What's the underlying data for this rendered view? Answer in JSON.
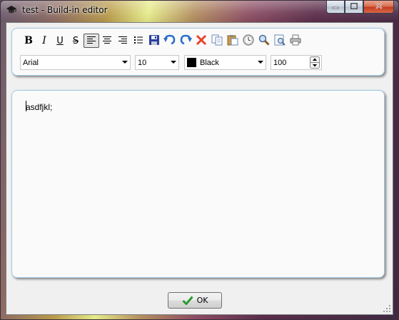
{
  "window": {
    "title": "test - Build-in editor",
    "controls": [
      "minimize-icon",
      "maximize-icon",
      "close-icon"
    ]
  },
  "toolbar": {
    "bold_label": "B",
    "italic_label": "I",
    "underline_label": "U",
    "strikethrough_label": "S",
    "align_left_pressed": true,
    "icons": [
      "align-left-icon",
      "align-center-icon",
      "align-right-icon",
      "bullet-list-icon",
      "save-icon",
      "undo-icon",
      "redo-icon",
      "delete-icon",
      "copy-icon",
      "paste-icon",
      "clock-icon",
      "find-icon",
      "replace-icon",
      "print-icon"
    ]
  },
  "format": {
    "font": "Arial",
    "size": "10",
    "color_name": "Black",
    "color_hex": "#000000",
    "zoom": "100"
  },
  "editor": {
    "content": "asdfjkl;"
  },
  "footer": {
    "ok_label": "OK"
  },
  "colors": {
    "panel_border": "#9ec9e8",
    "ok_check": "#2e9a2e",
    "delete_x": "#e8402a",
    "undo_blue": "#2a6fc9"
  }
}
